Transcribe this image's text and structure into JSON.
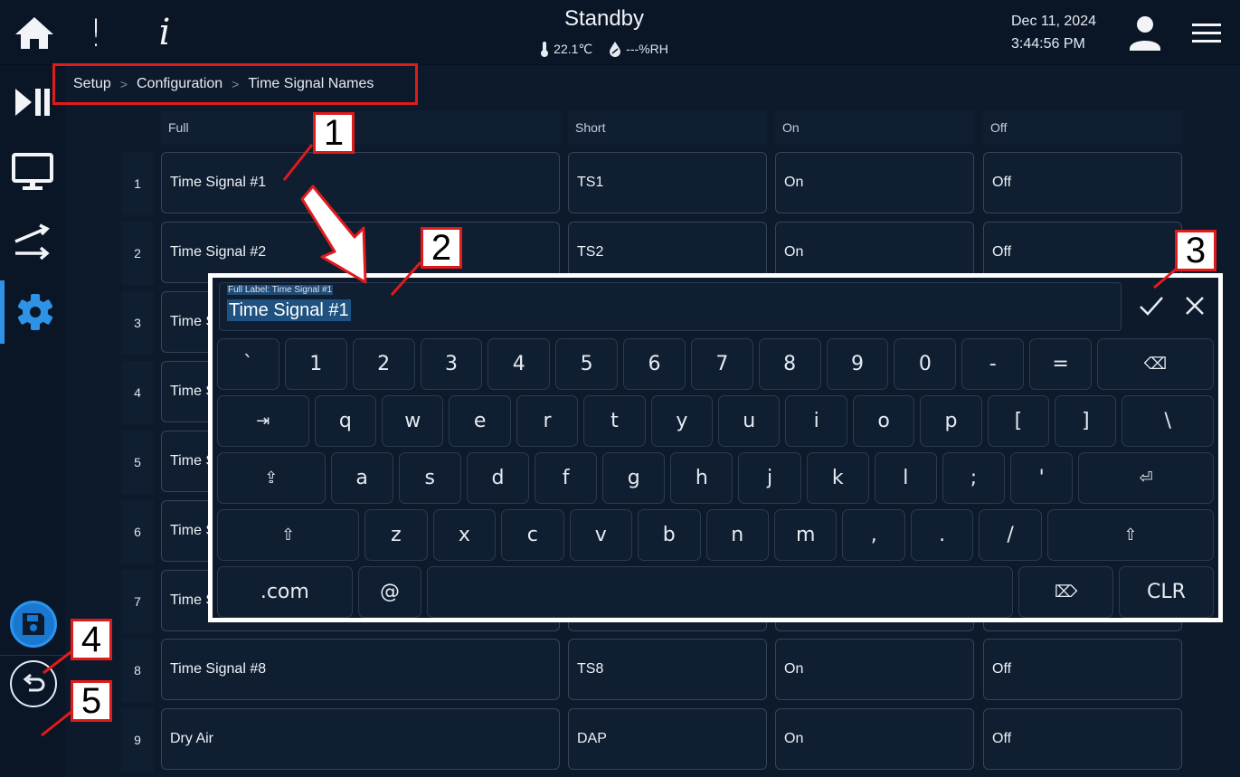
{
  "topbar": {
    "status_title": "Standby",
    "temperature": "22.1℃",
    "humidity": "---%RH",
    "date": "Dec 11, 2024",
    "time": "3:44:56 PM",
    "alert_glyph": "!",
    "info_glyph": "i"
  },
  "breadcrumb": [
    "Setup",
    "Configuration",
    "Time Signal Names"
  ],
  "table": {
    "headers": {
      "full": "Full",
      "short": "Short",
      "on": "On",
      "off": "Off"
    },
    "rows": [
      {
        "num": "1",
        "full": "Time Signal #1",
        "short": "TS1",
        "on": "On",
        "off": "Off"
      },
      {
        "num": "2",
        "full": "Time Signal #2",
        "short": "TS2",
        "on": "On",
        "off": "Off"
      },
      {
        "num": "3",
        "full": "Time S",
        "short": "",
        "on": "",
        "off": ""
      },
      {
        "num": "4",
        "full": "Time S",
        "short": "",
        "on": "",
        "off": ""
      },
      {
        "num": "5",
        "full": "Time S",
        "short": "",
        "on": "",
        "off": ""
      },
      {
        "num": "6",
        "full": "Time S",
        "short": "",
        "on": "",
        "off": ""
      },
      {
        "num": "7",
        "full": "Time S",
        "short": "",
        "on": "",
        "off": ""
      },
      {
        "num": "8",
        "full": "Time Signal #8",
        "short": "TS8",
        "on": "On",
        "off": "Off"
      },
      {
        "num": "9",
        "full": "Dry Air",
        "short": "DAP",
        "on": "On",
        "off": "Off"
      }
    ]
  },
  "keyboard": {
    "field_label": "Full Label: Time Signal #1",
    "field_value": "Time Signal #1",
    "rows": [
      [
        "`",
        "1",
        "2",
        "3",
        "4",
        "5",
        "6",
        "7",
        "8",
        "9",
        "0",
        "-",
        "=",
        "⌫"
      ],
      [
        "⇥",
        "q",
        "w",
        "e",
        "r",
        "t",
        "y",
        "u",
        "i",
        "o",
        "p",
        "[",
        "]",
        "\\"
      ],
      [
        "⇪",
        "a",
        "s",
        "d",
        "f",
        "g",
        "h",
        "j",
        "k",
        "l",
        ";",
        "'",
        "⏎"
      ],
      [
        "⇧",
        "z",
        "x",
        "c",
        "v",
        "b",
        "n",
        "m",
        ",",
        ".",
        "/",
        "⇧"
      ],
      [
        ".com",
        "@",
        "",
        "⌦",
        "CLR"
      ]
    ]
  },
  "callouts": [
    "1",
    "2",
    "3",
    "4",
    "5"
  ],
  "icons": {
    "home": "home-icon",
    "alert": "alert-icon",
    "info": "info-icon",
    "thermometer": "thermometer-icon",
    "humidity": "humidity-icon",
    "user": "user-icon",
    "menu": "menu-icon",
    "play_pause": "play-pause-icon",
    "monitor": "monitor-icon",
    "transfer": "transfer-icon",
    "settings": "gear-icon",
    "save": "save-icon",
    "back": "undo-icon",
    "confirm": "check-icon",
    "cancel": "close-icon"
  },
  "colors": {
    "accent": "#2e93e6",
    "callout_border": "#e01b1b",
    "background": "#0d1a2b"
  }
}
